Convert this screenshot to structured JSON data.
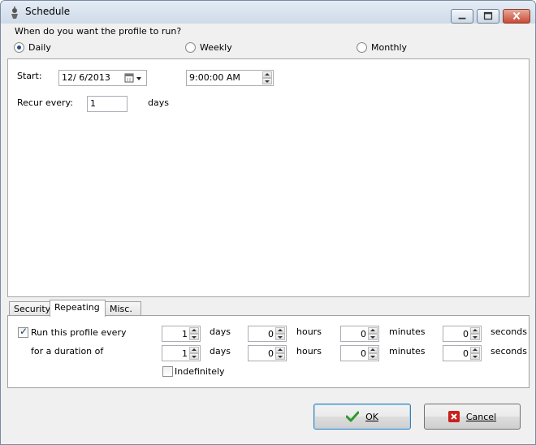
{
  "window": {
    "title": "Schedule"
  },
  "frequency": {
    "question": "When do you want the profile to run?",
    "options": [
      {
        "label": "Daily",
        "selected": true
      },
      {
        "label": "Weekly",
        "selected": false
      },
      {
        "label": "Monthly",
        "selected": false
      }
    ]
  },
  "daily": {
    "start_label": "Start:",
    "start_date": "12/ 6/2013",
    "start_time": "9:00:00 AM",
    "recur_label": "Recur every:",
    "recur_value": "1",
    "recur_unit": "days"
  },
  "tabs": [
    {
      "label": "Security",
      "active": false
    },
    {
      "label": "Repeating",
      "active": true
    },
    {
      "label": "Misc.",
      "active": false
    }
  ],
  "repeating": {
    "run_every_label": "Run this profile every",
    "run_every_checked": true,
    "duration_label": "for a duration of",
    "units": {
      "days": "days",
      "hours": "hours",
      "minutes": "minutes",
      "seconds": "seconds"
    },
    "run_every": {
      "days": "1",
      "hours": "0",
      "minutes": "0",
      "seconds": "0"
    },
    "duration": {
      "days": "1",
      "hours": "0",
      "minutes": "0",
      "seconds": "0"
    },
    "indefinitely_label": "Indefinitely",
    "indefinitely_checked": false
  },
  "buttons": {
    "ok": "OK",
    "cancel": "Cancel"
  },
  "colors": {
    "ok_icon": "#2e9a2e",
    "cancel_icon": "#c8211b",
    "title_gradient_top": "#e4ecf5"
  }
}
